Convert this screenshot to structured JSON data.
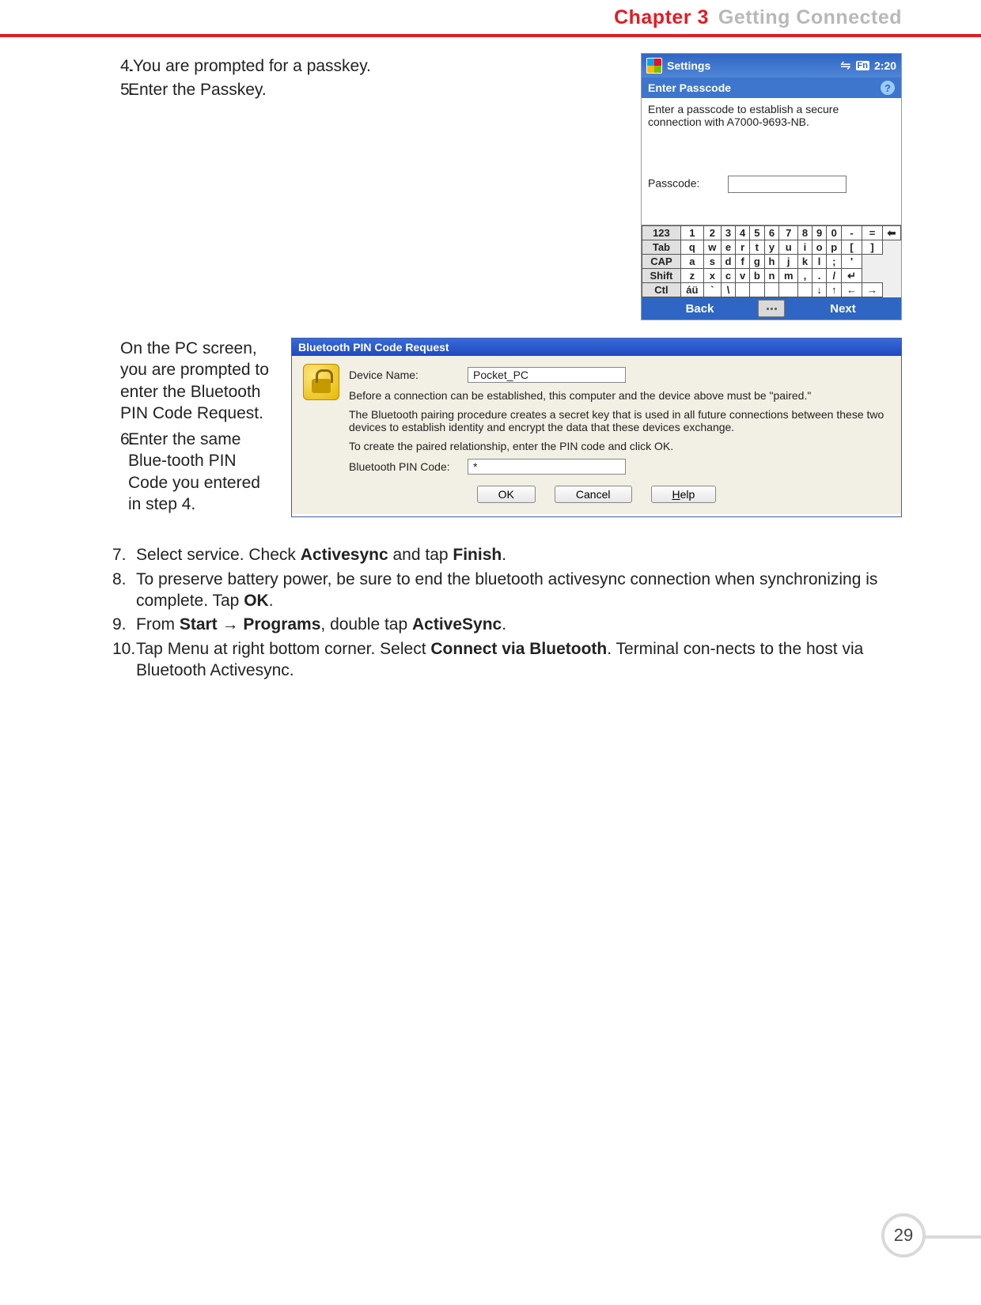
{
  "header": {
    "chapter": "Chapter 3",
    "title": "Getting Connected"
  },
  "steps_top": [
    {
      "n": "4.",
      "text": ".You are prompted for a passkey."
    },
    {
      "n": "5.",
      "text": "Enter the Passkey."
    }
  ],
  "pocket": {
    "settings_label": "Settings",
    "fn_label": "Fn",
    "time": "2:20",
    "subtitle": "Enter Passcode",
    "instruction": "Enter a passcode to establish a secure connection with A7000-9693-NB.",
    "passcode_label": "Passcode:",
    "keyboard": {
      "row1": [
        "123",
        "1",
        "2",
        "3",
        "4",
        "5",
        "6",
        "7",
        "8",
        "9",
        "0",
        "-",
        "=",
        "⬅"
      ],
      "row2": [
        "Tab",
        "q",
        "w",
        "e",
        "r",
        "t",
        "y",
        "u",
        "i",
        "o",
        "p",
        "[",
        "]"
      ],
      "row3": [
        "CAP",
        "a",
        "s",
        "d",
        "f",
        "g",
        "h",
        "j",
        "k",
        "l",
        ";",
        "'"
      ],
      "row4": [
        "Shift",
        "z",
        "x",
        "c",
        "v",
        "b",
        "n",
        "m",
        ",",
        ".",
        "/",
        "↵"
      ],
      "row5": [
        "Ctl",
        "áü",
        "`",
        "\\",
        "",
        "",
        "",
        "",
        "",
        "↓",
        "↑",
        "←",
        "→"
      ]
    },
    "back_label": "Back",
    "next_label": "Next"
  },
  "steps_mid_text1": "On the PC screen, you are prompted to enter the Bluetooth PIN Code Request.",
  "steps_mid": [
    {
      "n": "6.",
      "text": "Enter the same Blue-tooth PIN Code you entered in step 4."
    }
  ],
  "windlg": {
    "title": "Bluetooth PIN Code Request",
    "device_name_label": "Device Name:",
    "device_name_value": "Pocket_PC",
    "para1": "Before a connection can be established, this computer and the device above must be \"paired.\"",
    "para2": "The Bluetooth pairing procedure creates a secret key that is used in all future connections between these two devices to establish identity and encrypt the data that these devices exchange.",
    "para3": "To create the paired relationship, enter the PIN code and click OK.",
    "pin_label": "Bluetooth PIN Code:",
    "pin_value": "*",
    "ok": "OK",
    "cancel": "Cancel",
    "help_u": "H",
    "help_rest": "elp"
  },
  "steps_bottom": [
    {
      "n": "7.",
      "parts": [
        "Select service. Check ",
        {
          "b": "Activesync"
        },
        " and tap ",
        {
          "b": "Finish"
        },
        "."
      ]
    },
    {
      "n": "8.",
      "parts": [
        "To preserve battery power, be sure to end the bluetooth activesync connection when synchronizing is complete. Tap ",
        {
          "b": "OK"
        },
        "."
      ]
    },
    {
      "n": "9.",
      "parts": [
        "From ",
        {
          "b": "Start"
        },
        " → ",
        {
          "b": "Programs"
        },
        ", double tap ",
        {
          "b": "ActiveSync"
        },
        "."
      ]
    },
    {
      "n": "10.",
      "parts": [
        "Tap Menu at right bottom corner. Select ",
        {
          "b": "Connect via Bluetooth"
        },
        ". Terminal con-nects to the host via Bluetooth Activesync."
      ]
    }
  ],
  "page_number": "29"
}
